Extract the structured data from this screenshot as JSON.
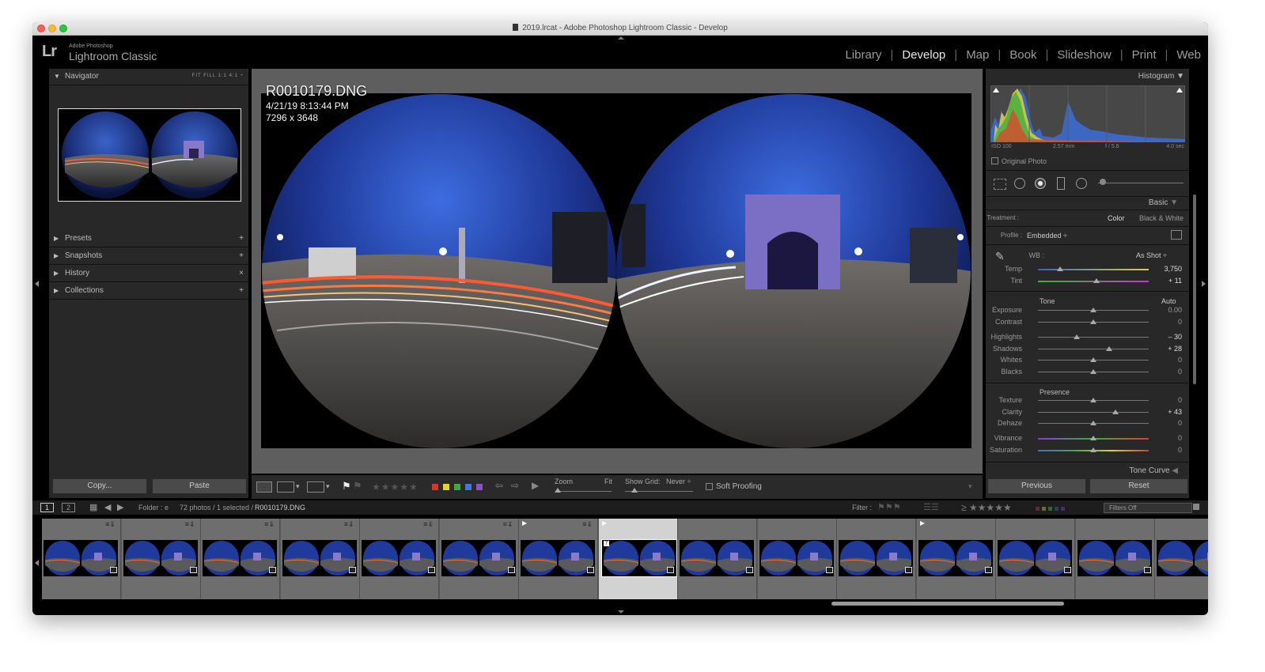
{
  "window": {
    "title": "2019.lrcat - Adobe Photoshop Lightroom Classic - Develop"
  },
  "identity": {
    "logo": "Lr",
    "vendor": "Adobe Photoshop",
    "product": "Lightroom Classic"
  },
  "modules": [
    {
      "label": "Library"
    },
    {
      "label": "Develop",
      "active": true
    },
    {
      "label": "Map"
    },
    {
      "label": "Book"
    },
    {
      "label": "Slideshow"
    },
    {
      "label": "Print"
    },
    {
      "label": "Web"
    }
  ],
  "left_panel": {
    "navigator": {
      "label": "Navigator",
      "zoom_options": "FIT  FILL  1:1  4:1 ÷"
    },
    "sections": [
      {
        "label": "Presets",
        "action": "+"
      },
      {
        "label": "Snapshots",
        "action": "+"
      },
      {
        "label": "History",
        "action": "×"
      },
      {
        "label": "Collections",
        "action": "+"
      }
    ],
    "copy_button": "Copy...",
    "paste_button": "Paste"
  },
  "photo": {
    "filename": "R0010179.DNG",
    "datetime": "4/21/19 8:13:44 PM",
    "dimensions": "7296 x 3648"
  },
  "toolbar": {
    "zoom_label": "Zoom",
    "zoom_value": "Fit",
    "grid_label": "Show Grid:",
    "grid_value": "Never ÷",
    "soft_proofing": "Soft Proofing",
    "stars": "★★★★★",
    "swatch_colors": [
      "#d9342b",
      "#e6d22a",
      "#3fa83f",
      "#3f78d8",
      "#8e4fc9"
    ]
  },
  "right_panel": {
    "histogram": {
      "label": "Histogram",
      "iso": "ISO 100",
      "focal": "2.57 mm",
      "aperture": "f / 5.6",
      "shutter": "4.0 sec",
      "original_photo": "Original Photo"
    },
    "basic": {
      "label": "Basic",
      "treatment_label": "Treatment :",
      "treatment_color": "Color",
      "treatment_bw": "Black & White",
      "profile_label": "Profile :",
      "profile_value": "Embedded ÷",
      "wb_label": "WB :",
      "wb_value": "As Shot ÷",
      "tone_label": "Tone",
      "auto_label": "Auto",
      "presence_label": "Presence",
      "sliders": [
        {
          "label": "Temp",
          "value": "3,750",
          "pos": 0.2
        },
        {
          "label": "Tint",
          "value": "+ 11",
          "pos": 0.53
        },
        {
          "label": "Exposure",
          "value": "0.00",
          "pos": 0.5
        },
        {
          "label": "Contrast",
          "value": "0",
          "pos": 0.5
        },
        {
          "label": "Highlights",
          "value": "– 30",
          "pos": 0.35
        },
        {
          "label": "Shadows",
          "value": "+ 28",
          "pos": 0.64
        },
        {
          "label": "Whites",
          "value": "0",
          "pos": 0.5
        },
        {
          "label": "Blacks",
          "value": "0",
          "pos": 0.5
        },
        {
          "label": "Texture",
          "value": "0",
          "pos": 0.5
        },
        {
          "label": "Clarity",
          "value": "+ 43",
          "pos": 0.7
        },
        {
          "label": "Dehaze",
          "value": "0",
          "pos": 0.5
        },
        {
          "label": "Vibrance",
          "value": "0",
          "pos": 0.5
        },
        {
          "label": "Saturation",
          "value": "0",
          "pos": 0.5
        }
      ]
    },
    "tone_curve": "Tone Curve",
    "previous_button": "Previous",
    "reset_button": "Reset"
  },
  "filmstrip_bar": {
    "page1": "1",
    "page2": "2",
    "folder_label": "Folder : e",
    "count_label": "72 photos / 1 selected /",
    "selected_file": "R0010179.DNG",
    "filter_label": "Filter :",
    "filter_stars": "≥ ★★★★★",
    "filters_off": "Filters Off"
  },
  "filmstrip": {
    "selected_number": "7"
  }
}
